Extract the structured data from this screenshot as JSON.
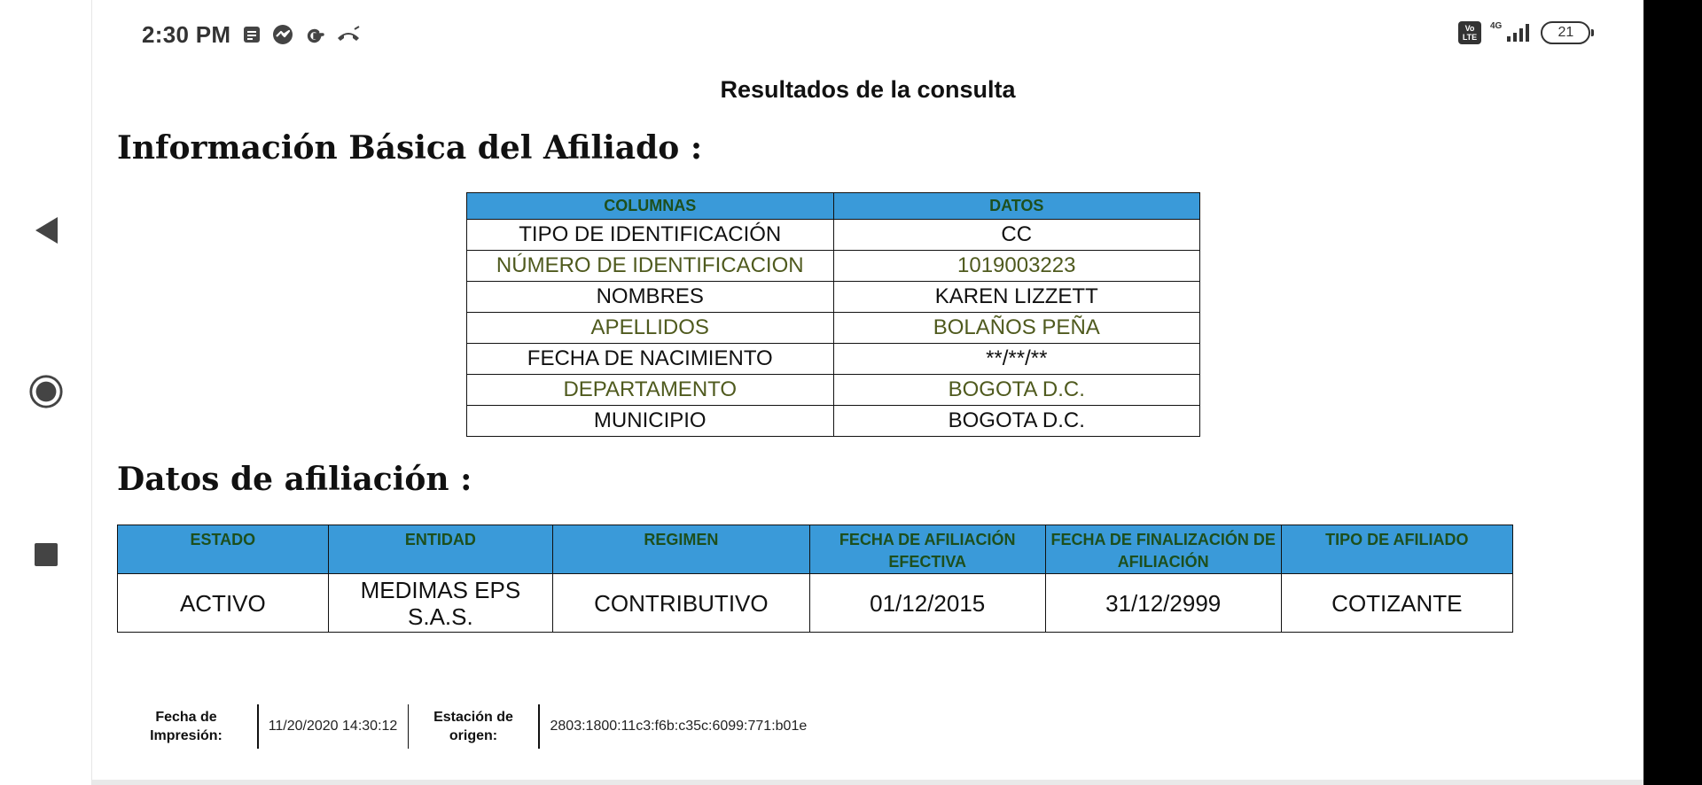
{
  "status_bar": {
    "time": "2:30 PM",
    "network": "4G",
    "battery": "21",
    "volte_top": "Vo",
    "volte_bottom": "LTE"
  },
  "page_header": "Resultados de la consulta",
  "basic_section": {
    "title": "Información Básica del Afiliado :",
    "columns": [
      "COLUMNAS",
      "DATOS"
    ],
    "rows": [
      {
        "label": "TIPO DE IDENTIFICACIÓN",
        "value": "CC"
      },
      {
        "label": "NÚMERO DE IDENTIFICACION",
        "value": "1019003223"
      },
      {
        "label": "NOMBRES",
        "value": "KAREN LIZZETT"
      },
      {
        "label": "APELLIDOS",
        "value": "BOLAÑOS PEÑA"
      },
      {
        "label": "FECHA DE NACIMIENTO",
        "value": "**/**/**"
      },
      {
        "label": "DEPARTAMENTO",
        "value": "BOGOTA D.C."
      },
      {
        "label": "MUNICIPIO",
        "value": "BOGOTA D.C."
      }
    ]
  },
  "affiliation_section": {
    "title": "Datos de afiliación :",
    "headers": [
      "ESTADO",
      "ENTIDAD",
      "REGIMEN",
      "FECHA DE AFILIACIÓN EFECTIVA",
      "FECHA DE FINALIZACIÓN DE AFILIACIÓN",
      "TIPO DE AFILIADO"
    ],
    "row": [
      "ACTIVO",
      "MEDIMAS EPS S.A.S.",
      "CONTRIBUTIVO",
      "01/12/2015",
      "31/12/2999",
      "COTIZANTE"
    ]
  },
  "footer": {
    "print_date_label": "Fecha de Impresión:",
    "print_date_value": "11/20/2020 14:30:12",
    "station_label": "Estación de origen:",
    "station_value": "2803:1800:11c3:f6b:c35c:6099:771:b01e"
  },
  "colors": {
    "header_blue": "#3a9ad9",
    "header_text_green": "#1d4f1d",
    "alt_row_olive": "#4f5a1e"
  },
  "icons": [
    "note-icon",
    "messenger-icon",
    "google-icon",
    "missed-call-icon",
    "volte-icon",
    "signal-icon",
    "battery-icon",
    "back-icon",
    "home-icon",
    "recents-icon"
  ]
}
